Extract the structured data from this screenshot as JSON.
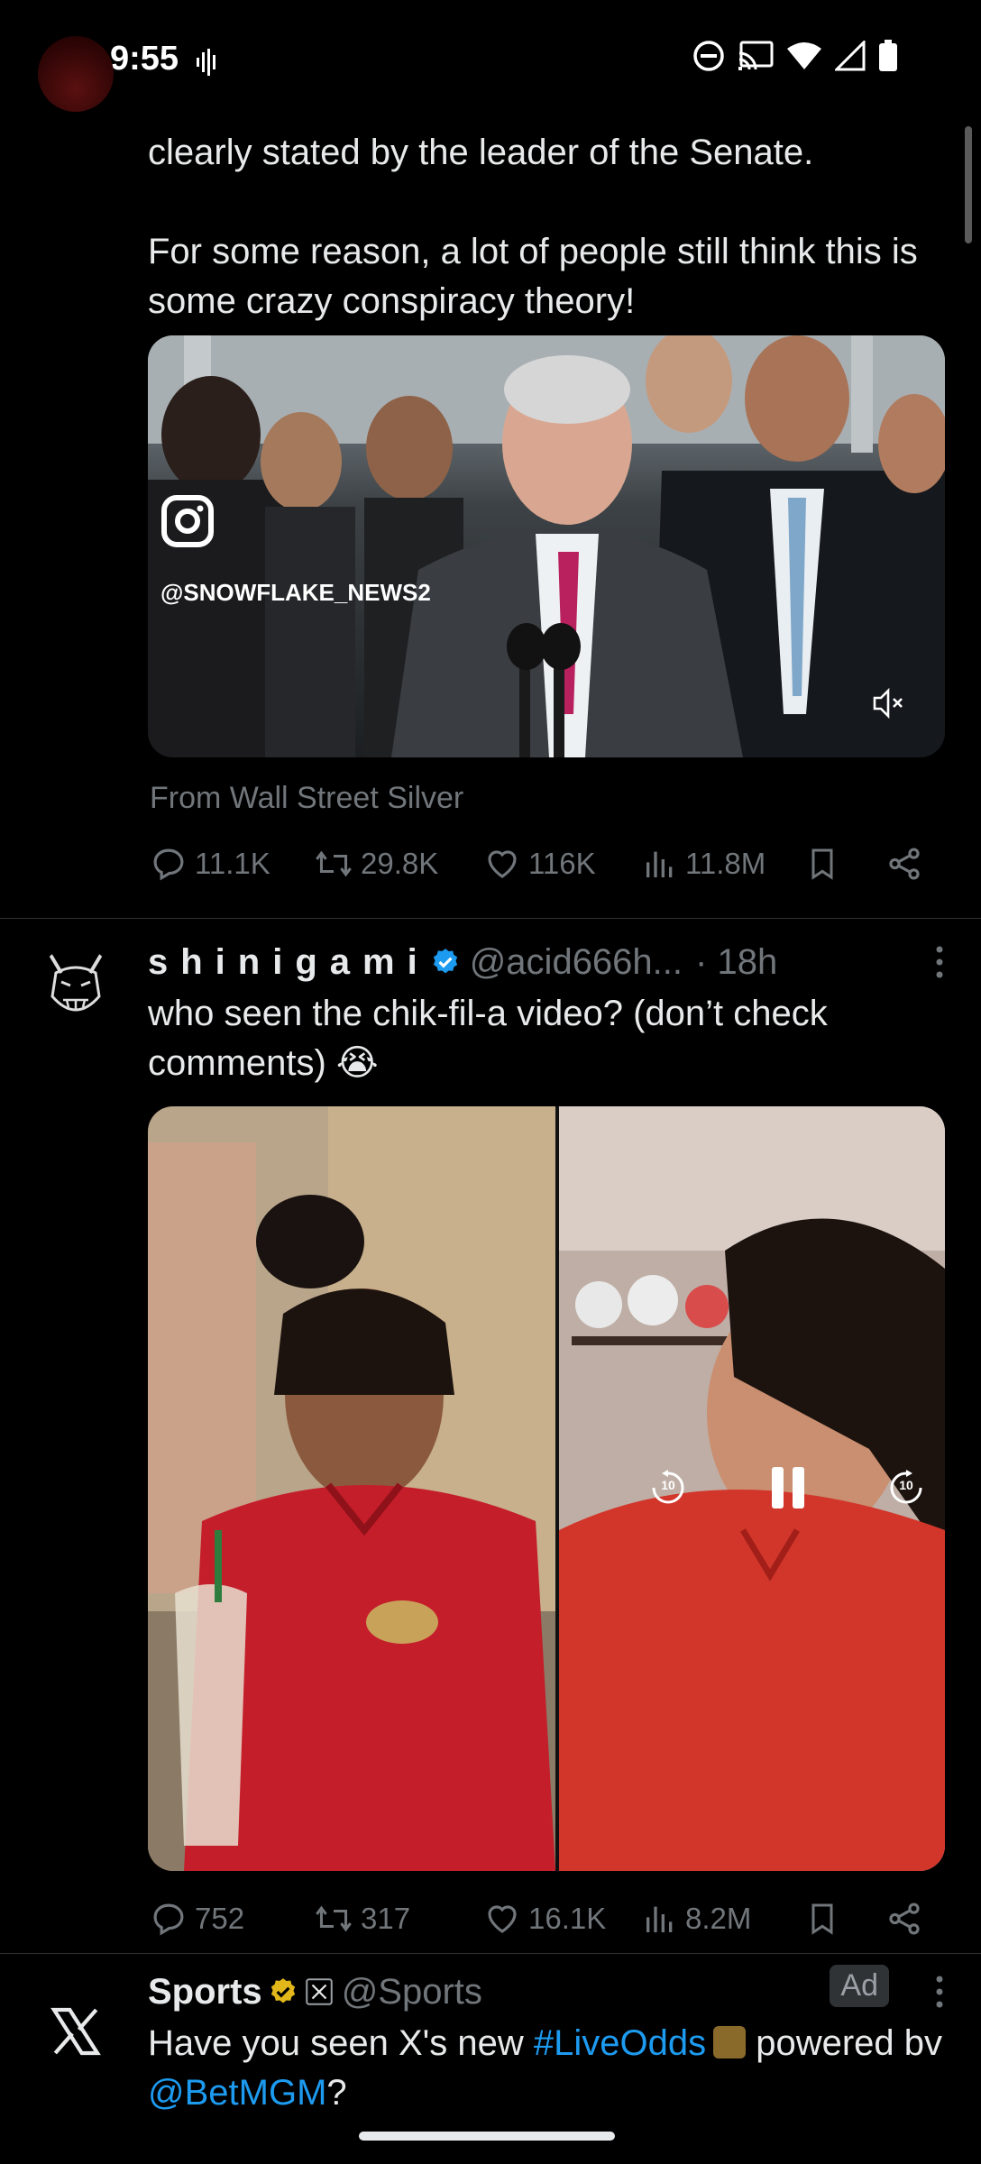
{
  "status_bar": {
    "time": "9:55"
  },
  "tweet1": {
    "text_partial": "clearly stated by the leader of the Senate.",
    "text_para2": "For some reason, a lot of people still think this is some crazy conspiracy theory!",
    "video_watermark": "@SNOWFLAKE_NEWS2",
    "source": "From Wall Street Silver",
    "stats": {
      "replies": "11.1K",
      "reposts": "29.8K",
      "likes": "116K",
      "views": "11.8M"
    }
  },
  "tweet2": {
    "name": "shinigami",
    "handle": "@acid666h...",
    "time": "· 18h",
    "text": "who seen the chik-fil-a video? (don’t check comments) 😭",
    "video_controls": {
      "rewind": "10",
      "forward": "10"
    },
    "stats": {
      "replies": "752",
      "reposts": "317",
      "likes": "16.1K",
      "views": "8.2M"
    }
  },
  "tweet3": {
    "name": "Sports",
    "handle": "@Sports",
    "ad_label": "Ad",
    "text_before": "Have you seen X's new ",
    "hashtag": "#LiveOdds",
    "text_mid": " powered bv ",
    "mention": "@BetMGM",
    "text_after": "?"
  },
  "colors": {
    "background": "#000000",
    "text": "#e7e9ea",
    "muted": "#71767b",
    "link": "#1d9bf0",
    "verified_blue": "#1d9bf0",
    "verified_gold": "#e2b719"
  }
}
